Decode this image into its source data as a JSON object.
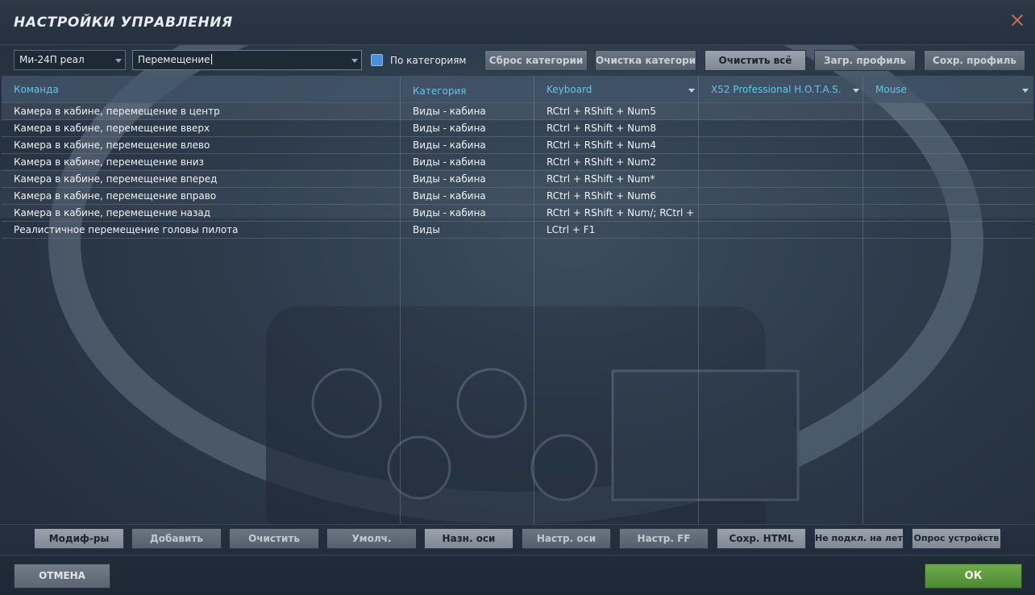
{
  "window": {
    "title": "НАСТРОЙКИ УПРАВЛЕНИЯ"
  },
  "toolbar": {
    "aircraft_select": "Ми-24П реал",
    "category_filter": "Перемещение",
    "by_category_checked": true,
    "by_category_label": "По категориям",
    "reset_category": "Сброс категории",
    "clear_category": "Очистка категории",
    "clear_all": "Очистить всё",
    "load_profile": "Загр. профиль",
    "save_profile": "Сохр. профиль"
  },
  "table": {
    "columns": [
      "Команда",
      "Категория",
      "Keyboard",
      "X52 Professional H.O.T.A.S.",
      "Mouse"
    ],
    "rows": [
      [
        "Камера в кабине, перемещение в центр",
        "Виды - кабина",
        "RCtrl + RShift + Num5",
        "",
        ""
      ],
      [
        "Камера в кабине, перемещение вверх",
        "Виды - кабина",
        "RCtrl + RShift + Num8",
        "",
        ""
      ],
      [
        "Камера в кабине, перемещение влево",
        "Виды - кабина",
        "RCtrl + RShift + Num4",
        "",
        ""
      ],
      [
        "Камера в кабине, перемещение вниз",
        "Виды - кабина",
        "RCtrl + RShift + Num2",
        "",
        ""
      ],
      [
        "Камера в кабине, перемещение вперед",
        "Виды - кабина",
        "RCtrl + RShift + Num*",
        "",
        ""
      ],
      [
        "Камера в кабине, перемещение вправо",
        "Виды - кабина",
        "RCtrl + RShift + Num6",
        "",
        ""
      ],
      [
        "Камера в кабине, перемещение назад",
        "Виды - кабина",
        "RCtrl + RShift + Num/; RCtrl + R",
        "",
        ""
      ],
      [
        "Реалистичное перемещение головы пилота",
        "Виды",
        "LCtrl + F1",
        "",
        ""
      ]
    ]
  },
  "bottom_buttons": {
    "modifiers": "Модиф-ры",
    "add": "Добавить",
    "clear": "Очистить",
    "default": "Умолч.",
    "assign_axis": "Назн. оси",
    "axis_tune": "Настр. оси",
    "ff_tune": "Настр. FF",
    "save_html": "Сохр. HTML",
    "not_connected": "Не подкл. на лету",
    "poll_devices": "Опрос устройств"
  },
  "footer": {
    "cancel": "ОТМЕНА",
    "ok": "ОК"
  },
  "colors": {
    "header_text": "#62c4ee",
    "ok_button": "#5c9a3e",
    "close_icon": "#c4714a"
  }
}
